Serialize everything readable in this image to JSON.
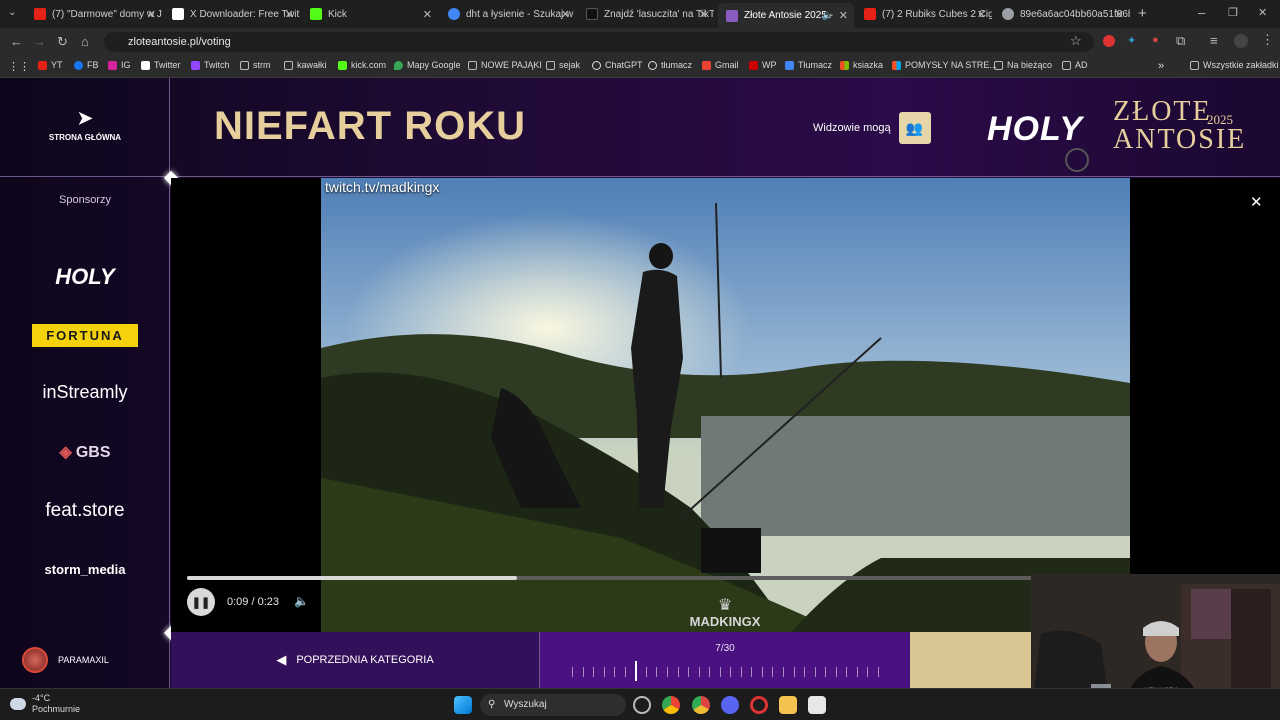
{
  "browser": {
    "tabs": [
      {
        "title": "(7) \"Darmowe\" domy w Ja",
        "color": "#e62117"
      },
      {
        "title": "X Downloader: Free Twitt",
        "color": "#ffffff"
      },
      {
        "title": "Kick",
        "color": "#53fc18"
      },
      {
        "title": "dht a łysienie - Szukaj w",
        "color": "#4285f4"
      },
      {
        "title": "Znajdź 'lasuczita' na TikTo",
        "color": "#000000"
      },
      {
        "title": "Złote Antosie 2025 -",
        "color": "#8a5cc2"
      },
      {
        "title": "(7) 2 Rubiks Cubes 2 Cig",
        "color": "#e62117"
      },
      {
        "title": "89e6a6ac04bb60a51f06b",
        "color": "#9aa0a6"
      }
    ],
    "url": "zloteantosie.pl/voting",
    "bookmarks": [
      "YT",
      "FB",
      "IG",
      "Twitter",
      "Twitch",
      "strm",
      "kawałki",
      "kick.com",
      "Mapy Google",
      "NOWE PAJĄKI",
      "sejak",
      "ChatGPT",
      "tłumacz",
      "Gmail",
      "WP",
      "Tłumacz",
      "ksiazka",
      "POMYSŁY NA STRE...",
      "Na bieżąco",
      "AD"
    ],
    "all_bookmarks": "Wszystkie zakładki"
  },
  "page": {
    "home_label": "STRONA GŁÓWNA",
    "category_title": "NIEFART ROKU",
    "viewers_label": "Widzowie mogą",
    "brand": {
      "holy": "HOLY",
      "title_line1": "ZŁOTE",
      "title_line2": "ANTOSIE",
      "year": "2025"
    },
    "sponsors_label": "Sponsorzy",
    "sponsors": [
      "HOLY",
      "FORTUNA",
      "inStreamly",
      "GBS",
      "feat.store",
      "storm_media"
    ]
  },
  "video": {
    "overlay_url": "twitch.tv/madkingx",
    "time": "0:09 / 0:23",
    "progress": 0.39,
    "watermark": "MADKINGX"
  },
  "bottom": {
    "username": "PARAMAXIL",
    "prev_category": "POPRZEDNIA KATEGORIA",
    "pager": "7/30",
    "current_index": 7,
    "total": 30
  },
  "taskbar": {
    "weather_temp": "-4°C",
    "weather_desc": "Pochmurnie",
    "search_placeholder": "Wyszukaj"
  },
  "colors": {
    "accent_gold": "#e6cf9c",
    "purple": "#4a1280"
  }
}
